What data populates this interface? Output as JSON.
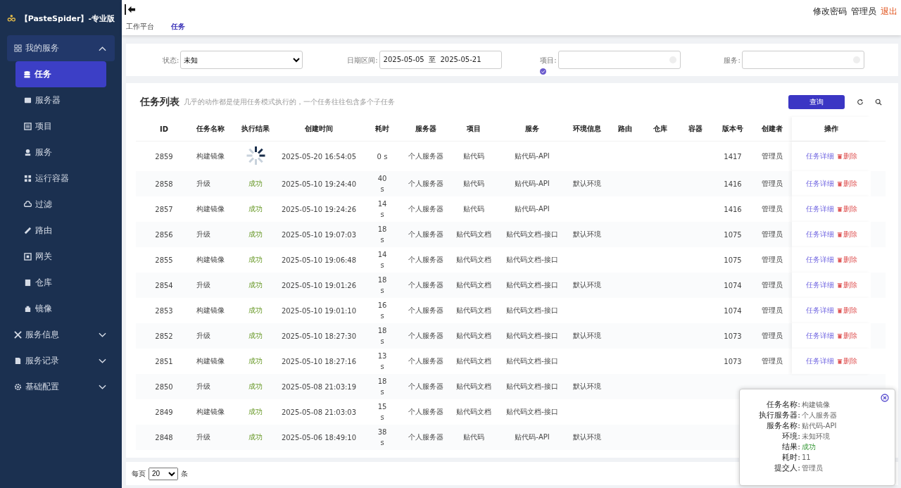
{
  "brand": {
    "title": "【PasteSpider】-专业版"
  },
  "sidebar": {
    "items": [
      {
        "label": "我的服务",
        "expanded": true,
        "children": [
          {
            "label": "任务",
            "selected": true
          },
          {
            "label": "服务器",
            "selected": false
          },
          {
            "label": "项目",
            "selected": false
          },
          {
            "label": "服务",
            "selected": false
          },
          {
            "label": "运行容器",
            "selected": false
          },
          {
            "label": "过滤",
            "selected": false
          },
          {
            "label": "路由",
            "selected": false
          },
          {
            "label": "网关",
            "selected": false
          },
          {
            "label": "仓库",
            "selected": false
          },
          {
            "label": "镜像",
            "selected": false
          }
        ]
      },
      {
        "label": "服务信息",
        "expanded": false
      },
      {
        "label": "服务记录",
        "expanded": false
      },
      {
        "label": "基础配置",
        "expanded": false
      }
    ]
  },
  "header": {
    "tabs": [
      {
        "label": "工作平台",
        "selected": false
      },
      {
        "label": "任务",
        "selected": true
      }
    ],
    "links": [
      {
        "label": "修改密码",
        "kind": "normal"
      },
      {
        "label": "管理员",
        "kind": "normal"
      },
      {
        "label": "退出",
        "kind": "danger"
      }
    ]
  },
  "filters": {
    "status": {
      "label": "状态:",
      "value": "未知"
    },
    "date": {
      "label": "日期区间:",
      "value": "2025-05-05  至  2025-05-21"
    },
    "project": {
      "label": "项目:",
      "checked": true
    },
    "service": {
      "label": "服务:"
    }
  },
  "table": {
    "title": "任务列表",
    "subtitle": "几乎的动作都是使用任务模式执行的，一个任务往往包含多个子任务",
    "query_button": "查询",
    "columns": [
      "ID",
      "任务名称",
      "执行结果",
      "创建时间",
      "耗时",
      "服务器",
      "项目",
      "服务",
      "环境信息",
      "路由",
      "仓库",
      "容器",
      "版本号",
      "创建者",
      "操作"
    ],
    "rows": [
      {
        "id": "2859",
        "name": "构建镜像",
        "result": {
          "kind": "spinner"
        },
        "time": "2025-05-20 16:54:05",
        "duration": "0 s",
        "server": "个人服务器",
        "project": "贴代码",
        "service": "贴代码-API",
        "version": "1417",
        "creator": "管理员",
        "detail": "任务详细",
        "delete": "删除"
      },
      {
        "id": "2858",
        "name": "升级",
        "result": {
          "kind": "text",
          "text": "成功"
        },
        "time": "2025-05-10 19:24:40",
        "duration": "40 s",
        "server": "个人服务器",
        "project": "贴代码",
        "service": "贴代码-API",
        "env": "默认环境",
        "version": "1416",
        "creator": "管理员",
        "detail": "任务详细",
        "delete": "删除"
      },
      {
        "id": "2857",
        "name": "构建镜像",
        "result": {
          "kind": "text",
          "text": "成功"
        },
        "time": "2025-05-10 19:24:26",
        "duration": "14 s",
        "server": "个人服务器",
        "project": "贴代码",
        "service": "贴代码-API",
        "version": "1416",
        "creator": "管理员",
        "detail": "任务详细",
        "delete": "删除"
      },
      {
        "id": "2856",
        "name": "升级",
        "result": {
          "kind": "text",
          "text": "成功"
        },
        "time": "2025-05-10 19:07:03",
        "duration": "18 s",
        "server": "个人服务器",
        "project": "贴代码文档",
        "service": "贴代码文档-接口",
        "env": "默认环境",
        "version": "1075",
        "creator": "管理员",
        "detail": "任务详细",
        "delete": "删除"
      },
      {
        "id": "2855",
        "name": "构建镜像",
        "result": {
          "kind": "text",
          "text": "成功"
        },
        "time": "2025-05-10 19:06:48",
        "duration": "14 s",
        "server": "个人服务器",
        "project": "贴代码文档",
        "service": "贴代码文档-接口",
        "version": "1075",
        "creator": "管理员",
        "detail": "任务详细",
        "delete": "删除"
      },
      {
        "id": "2854",
        "name": "升级",
        "result": {
          "kind": "text",
          "text": "成功"
        },
        "time": "2025-05-10 19:01:26",
        "duration": "18 s",
        "server": "个人服务器",
        "project": "贴代码文档",
        "service": "贴代码文档-接口",
        "env": "默认环境",
        "version": "1074",
        "creator": "管理员",
        "detail": "任务详细",
        "delete": "删除"
      },
      {
        "id": "2853",
        "name": "构建镜像",
        "result": {
          "kind": "text",
          "text": "成功"
        },
        "time": "2025-05-10 19:01:10",
        "duration": "16 s",
        "server": "个人服务器",
        "project": "贴代码文档",
        "service": "贴代码文档-接口",
        "version": "1074",
        "creator": "管理员",
        "detail": "任务详细",
        "delete": "删除"
      },
      {
        "id": "2852",
        "name": "升级",
        "result": {
          "kind": "text",
          "text": "成功"
        },
        "time": "2025-05-10 18:27:30",
        "duration": "18 s",
        "server": "个人服务器",
        "project": "贴代码文档",
        "service": "贴代码文档-接口",
        "env": "默认环境",
        "version": "1073",
        "creator": "管理员",
        "detail": "任务详细",
        "delete": "删除"
      },
      {
        "id": "2851",
        "name": "构建镜像",
        "result": {
          "kind": "text",
          "text": "成功"
        },
        "time": "2025-05-10 18:27:16",
        "duration": "13 s",
        "server": "个人服务器",
        "project": "贴代码文档",
        "service": "贴代码文档-接口",
        "version": "1073",
        "creator": "管理员",
        "detail": "任务详细",
        "delete": "删除"
      },
      {
        "id": "2850",
        "name": "升级",
        "result": {
          "kind": "text",
          "text": "成功"
        },
        "time": "2025-05-08 21:03:19",
        "duration": "18 s",
        "server": "个人服务器",
        "project": "贴代码文档",
        "service": "贴代码文档-接口",
        "env": "默认环境"
      },
      {
        "id": "2849",
        "name": "构建镜像",
        "result": {
          "kind": "text",
          "text": "成功"
        },
        "time": "2025-05-08 21:03:03",
        "duration": "15 s",
        "server": "个人服务器",
        "project": "贴代码文档",
        "service": "贴代码文档-接口"
      },
      {
        "id": "2848",
        "name": "升级",
        "result": {
          "kind": "text",
          "text": "成功"
        },
        "time": "2025-05-06 18:49:10",
        "duration": "38 s",
        "server": "个人服务器",
        "project": "贴代码",
        "service": "贴代码-API",
        "env": "默认环境"
      }
    ]
  },
  "footer": {
    "per_page_label": "每页",
    "per_page": "20",
    "per_page_unit": "条"
  },
  "popup": {
    "fields": [
      {
        "label": "任务名称:",
        "value": "构建镜像",
        "kind": "normal"
      },
      {
        "label": "执行服务器:",
        "value": "个人服务器",
        "kind": "normal"
      },
      {
        "label": "服务名称:",
        "value": "贴代码-API",
        "kind": "normal"
      },
      {
        "label": "环境:",
        "value": "未知环境",
        "kind": "normal"
      },
      {
        "label": "结果:",
        "value": "成功",
        "kind": "success"
      },
      {
        "label": "耗时:",
        "value": "11",
        "kind": "normal"
      },
      {
        "label": "提交人:",
        "value": "管理员",
        "kind": "normal"
      }
    ]
  }
}
